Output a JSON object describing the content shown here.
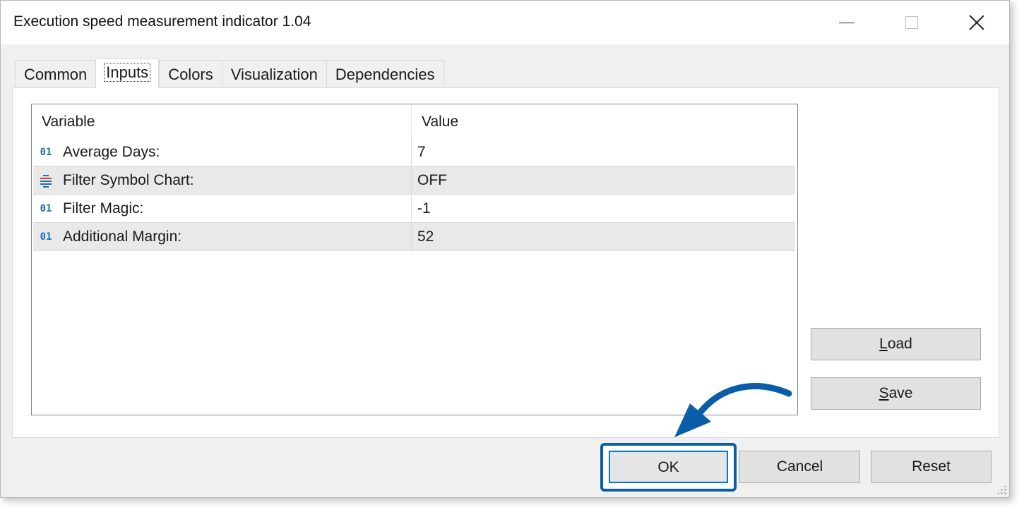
{
  "window": {
    "title": "Execution speed measurement indicator 1.04"
  },
  "tabs": [
    {
      "label": "Common"
    },
    {
      "label": "Inputs"
    },
    {
      "label": "Colors"
    },
    {
      "label": "Visualization"
    },
    {
      "label": "Dependencies"
    }
  ],
  "active_tab": "Inputs",
  "grid": {
    "columns": {
      "variable": "Variable",
      "value": "Value"
    },
    "rows": [
      {
        "icon": "int-icon",
        "variable": "Average Days:",
        "value": "7"
      },
      {
        "icon": "enum-icon",
        "variable": "Filter Symbol Chart:",
        "value": "OFF"
      },
      {
        "icon": "int-icon",
        "variable": "Filter Magic:",
        "value": "-1"
      },
      {
        "icon": "int-icon",
        "variable": "Additional Margin:",
        "value": "52"
      }
    ],
    "int_icon_text": "01"
  },
  "side_buttons": {
    "load": {
      "mnemonic": "L",
      "rest": "oad"
    },
    "save": {
      "mnemonic": "S",
      "rest": "ave"
    }
  },
  "buttons": {
    "ok": "OK",
    "cancel": "Cancel",
    "reset": "Reset"
  },
  "colors": {
    "highlight": "#0a5ea8",
    "int_icon": "#1b6fb3",
    "enum_icon_red": "#d9352b",
    "enum_icon_blue": "#1b6fb3"
  }
}
